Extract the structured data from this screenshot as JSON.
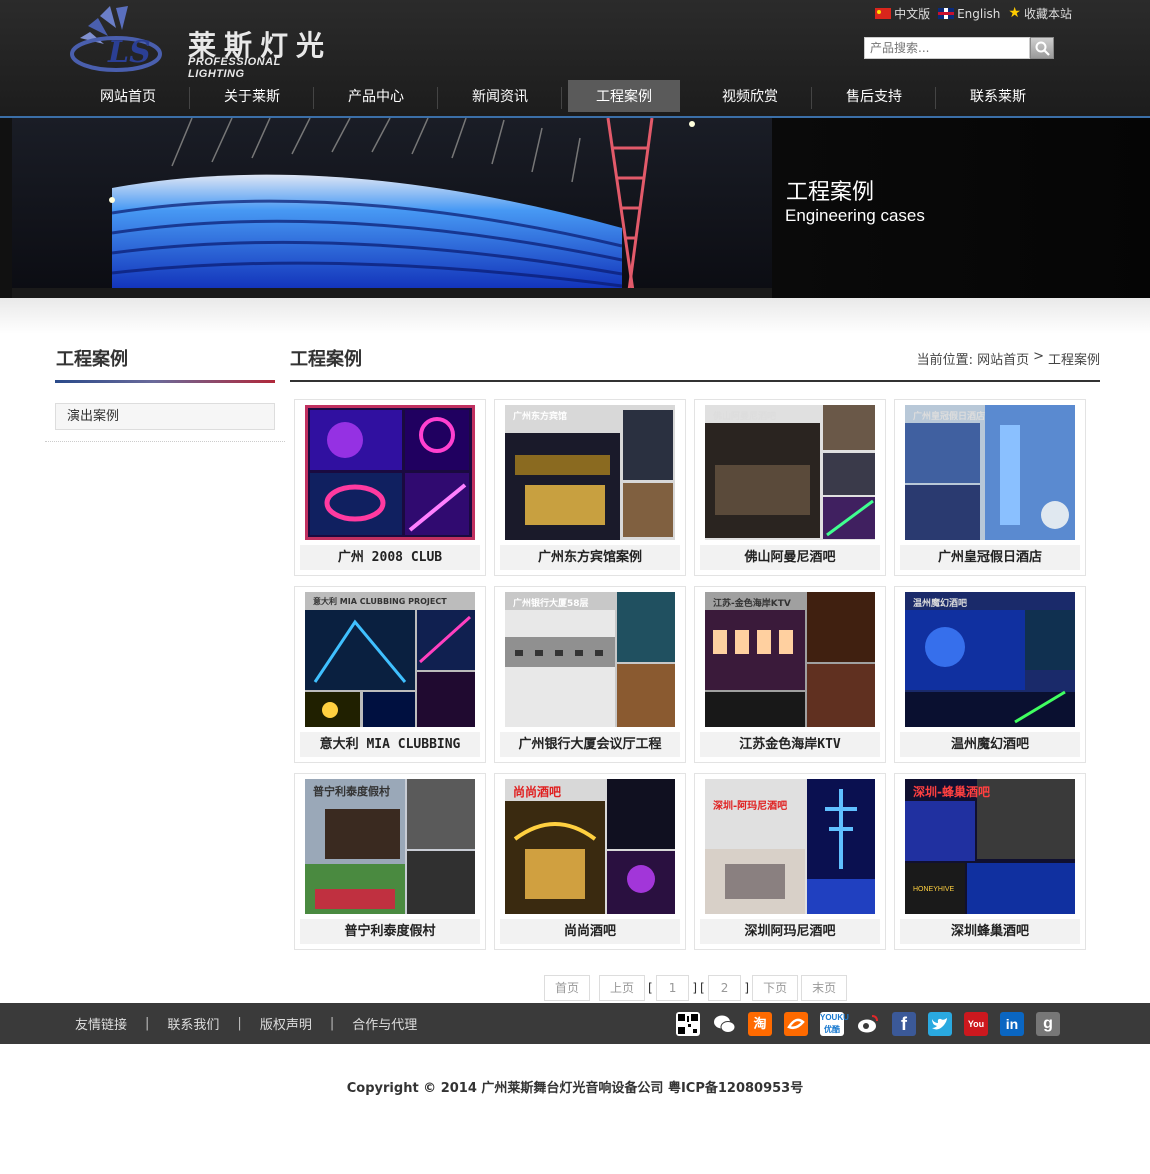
{
  "brand": {
    "cn": "莱斯灯光",
    "en": "PROFESSIONAL LIGHTING",
    "mark": "LS"
  },
  "toplinks": {
    "chinese": "中文版",
    "english": "English",
    "bookmark": "收藏本站"
  },
  "search": {
    "placeholder": "产品搜索..."
  },
  "nav": [
    {
      "label": "网站首页"
    },
    {
      "label": "关于莱斯"
    },
    {
      "label": "产品中心"
    },
    {
      "label": "新闻资讯"
    },
    {
      "label": "工程案例",
      "active": true
    },
    {
      "label": "视频欣赏"
    },
    {
      "label": "售后支持"
    },
    {
      "label": "联系莱斯"
    }
  ],
  "banner": {
    "title": "工程案例",
    "subtitle": "Engineering cases"
  },
  "sidebar": {
    "title": "工程案例",
    "items": [
      {
        "label": "演出案例"
      }
    ]
  },
  "main": {
    "title": "工程案例",
    "breadcrumb": {
      "prefix": "当前位置:",
      "home": "网站首页",
      "sep": ">",
      "current": "工程案例"
    }
  },
  "cases": [
    {
      "caption": "广州 2008 CLUB",
      "img_label": ""
    },
    {
      "caption": "广州东方宾馆案例",
      "img_label": "广州东方宾馆"
    },
    {
      "caption": "佛山阿曼尼酒吧",
      "img_label": "佛山阿曼尼酒吧"
    },
    {
      "caption": "广州皇冠假日酒店",
      "img_label": "广州皇冠假日酒店"
    },
    {
      "caption": "意大利 MIA CLUBBING",
      "img_label": "意大利 MIA CLUBBING PROJECT"
    },
    {
      "caption": "广州银行大厦会议厅工程",
      "img_label": "广州银行大厦58层"
    },
    {
      "caption": "江苏金色海岸KTV",
      "img_label": "江苏-金色海岸KTV"
    },
    {
      "caption": "温州魔幻酒吧",
      "img_label": "温州魔幻酒吧"
    },
    {
      "caption": "普宁利泰度假村",
      "img_label": "普宁利泰度假村"
    },
    {
      "caption": "尚尚酒吧",
      "img_label": "尚尚酒吧"
    },
    {
      "caption": "深圳阿玛尼酒吧",
      "img_label": "深圳-阿玛尼酒吧"
    },
    {
      "caption": "深圳蜂巢酒吧",
      "img_label": "深圳-蜂巢酒吧"
    }
  ],
  "pager": {
    "first": "首页",
    "prev": "上页",
    "page1": "1",
    "page2": "2",
    "next": "下页",
    "last": "末页",
    "lb": "[",
    "rb": "]"
  },
  "footer": {
    "links": [
      "友情链接",
      "联系我们",
      "版权声明",
      "合作与代理"
    ],
    "sep": "|",
    "social": [
      {
        "icon": "qrcode-icon",
        "color": "#ffffff"
      },
      {
        "icon": "wechat-icon",
        "color": "#ffffff"
      },
      {
        "icon": "taobao-icon",
        "color": "#ff6a00",
        "text": "淘"
      },
      {
        "icon": "alibaba-icon",
        "color": "#ff6a00"
      },
      {
        "icon": "youku-icon",
        "color": "#ffffff"
      },
      {
        "icon": "weibo-icon",
        "color": "#ffffff"
      },
      {
        "icon": "facebook-icon",
        "color": "#3b5998",
        "text": "f"
      },
      {
        "icon": "twitter-icon",
        "color": "#2aa9e0"
      },
      {
        "icon": "youtube-icon",
        "color": "#cc181e",
        "text": "You"
      },
      {
        "icon": "linkedin-icon",
        "color": "#0a66c2",
        "text": "in"
      },
      {
        "icon": "google-icon",
        "color": "#777777",
        "text": "g"
      }
    ],
    "copyright": "Copyright © 2014 广州莱斯舞台灯光音响设备公司  粤ICP备12080953号"
  }
}
